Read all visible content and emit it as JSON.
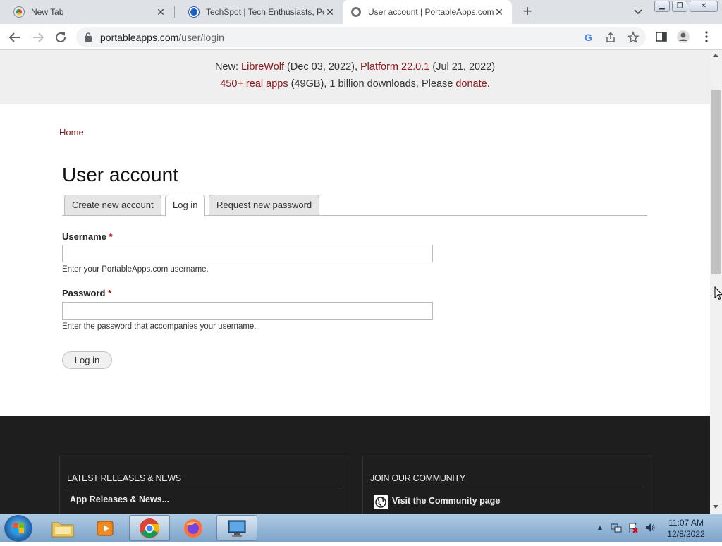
{
  "browser": {
    "tabs": [
      {
        "title": "New Tab",
        "active": false
      },
      {
        "title": "TechSpot | Tech Enthusiasts, Pow",
        "active": false
      },
      {
        "title": "User account | PortableApps.com",
        "active": true
      }
    ],
    "url_domain": "portableapps.com",
    "url_path": "/user/login"
  },
  "banner": {
    "line1_prefix": "New: ",
    "libre_link": "LibreWolf",
    "libre_date": " (Dec 03, 2022), ",
    "platform_link": "Platform 22.0.1",
    "platform_date": " (Jul 21, 2022)",
    "apps_link": "450+ real apps",
    "line2_middle": " (49GB), 1 billion downloads, Please ",
    "donate_link": "donate."
  },
  "page": {
    "breadcrumb": "Home",
    "title": "User account",
    "tabs": [
      "Create new account",
      "Log in",
      "Request new password"
    ],
    "active_tab": "Log in",
    "username_label": "Username",
    "username_help": "Enter your PortableApps.com username.",
    "password_label": "Password",
    "password_help": "Enter the password that accompanies your username.",
    "required_mark": "*",
    "submit_label": "Log in"
  },
  "footer": {
    "news_heading": "LATEST RELEASES & NEWS",
    "news_item": "App Releases & News...",
    "community_heading": "JOIN OUR COMMUNITY",
    "community_item": "Visit the Community page"
  },
  "taskbar": {
    "time": "11:07 AM",
    "date": "12/8/2022"
  },
  "colors": {
    "link": "#8b1a1a",
    "footer_bg": "#1e1e1e",
    "banner_bg": "#efefef"
  }
}
